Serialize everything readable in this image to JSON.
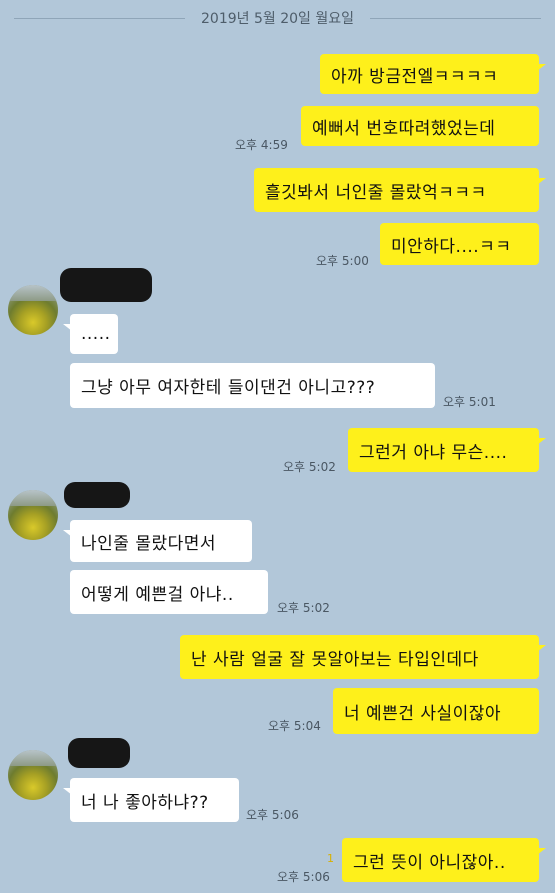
{
  "date_separator": "2019년 5월 20일 월요일",
  "messages": [
    {
      "text": "아까 방금전엘ㅋㅋㅋㅋ"
    },
    {
      "text": "예뻐서 번호따려했었는데"
    },
    {
      "text": "흘깃봐서 너인줄 몰랐억ㅋㅋㅋ"
    },
    {
      "text": "미안하다....ㅋㅋ"
    },
    {
      "text": "....."
    },
    {
      "text": "그냥 아무 여자한테 들이댄건 아니고???"
    },
    {
      "text": "그런거 아냐 무슨...."
    },
    {
      "text": "나인줄 몰랐다면서"
    },
    {
      "text": "어떻게 예쁜걸 아냐.."
    },
    {
      "text": "난 사람 얼굴 잘 못알아보는 타입인데다"
    },
    {
      "text": "너 예쁜건 사실이잖아"
    },
    {
      "text": "너 나 좋아하냐??"
    },
    {
      "text": "그런 뜻이 아니잖아.."
    }
  ],
  "times": {
    "t1": "오후 4:59",
    "t2": "오후 5:00",
    "t3": "오후 5:01",
    "t4": "오후 5:02",
    "t5": "오후 5:02",
    "t6": "오후 5:04",
    "t7": "오후 5:06",
    "t8": "오후 5:06"
  },
  "unread_count": "1",
  "colors": {
    "background": "#b2c7d9",
    "my_bubble": "#fef01b",
    "other_bubble": "#ffffff"
  }
}
